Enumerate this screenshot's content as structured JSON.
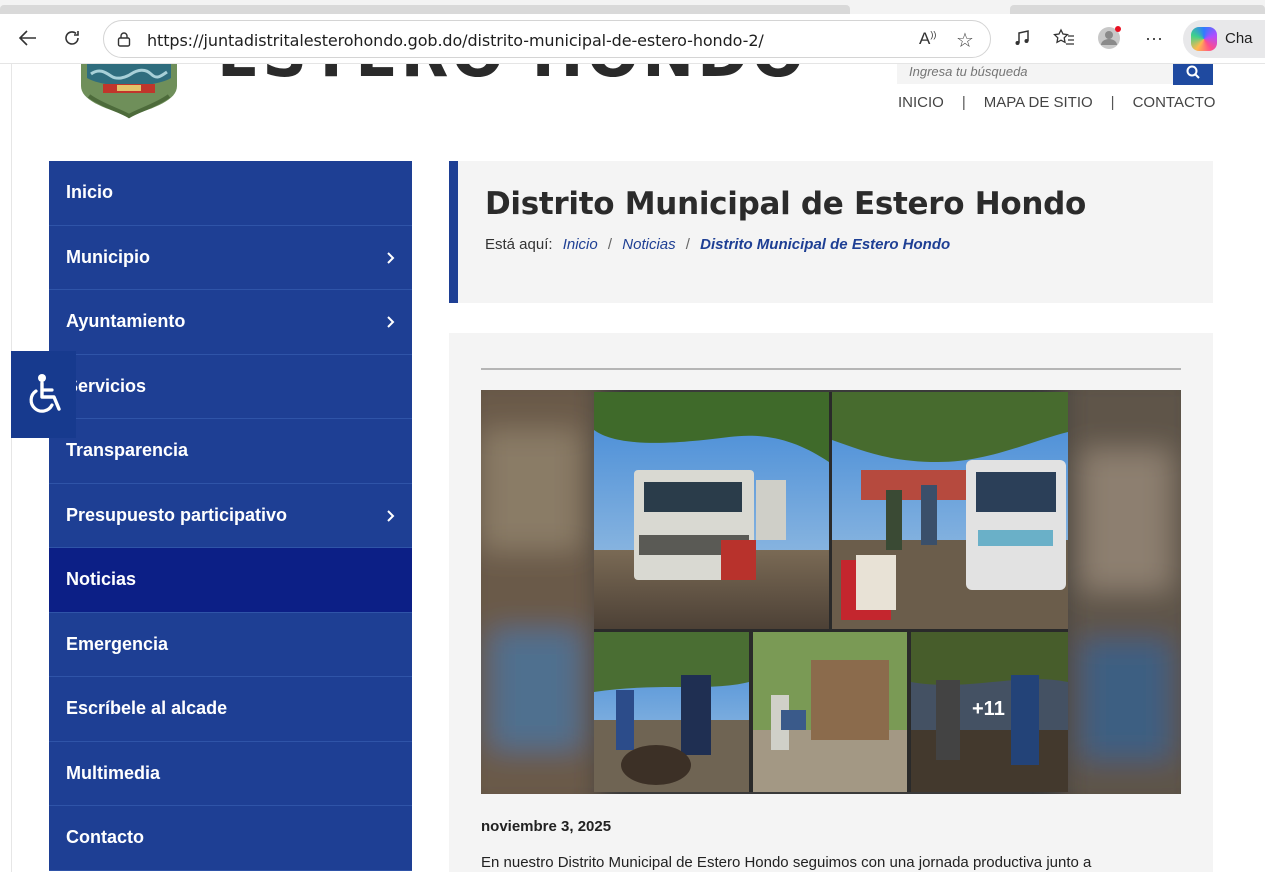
{
  "browser": {
    "url": "https://juntadistritalesterohondo.gob.do/distrito-municipal-de-estero-hondo-2/",
    "copilot_label": "Cha",
    "read_aloud_glyph": "A̩"
  },
  "site": {
    "name": "ESTERO HONDO",
    "search_placeholder": "Ingresa tu búsqueda",
    "top_nav": [
      "INICIO",
      "MAPA DE SITIO",
      "CONTACTO"
    ],
    "nav_separator": "|"
  },
  "sidebar": {
    "items": [
      {
        "label": "Inicio",
        "has_submenu": false,
        "active": false
      },
      {
        "label": "Municipio",
        "has_submenu": true,
        "active": false
      },
      {
        "label": "Ayuntamiento",
        "has_submenu": true,
        "active": false
      },
      {
        "label": "Servicios",
        "has_submenu": false,
        "active": false
      },
      {
        "label": "Transparencia",
        "has_submenu": false,
        "active": false
      },
      {
        "label": "Presupuesto participativo",
        "has_submenu": true,
        "active": false
      },
      {
        "label": "Noticias",
        "has_submenu": false,
        "active": true
      },
      {
        "label": "Emergencia",
        "has_submenu": false,
        "active": false
      },
      {
        "label": "Escríbele al alcade",
        "has_submenu": false,
        "active": false
      },
      {
        "label": "Multimedia",
        "has_submenu": false,
        "active": false
      },
      {
        "label": "Contacto",
        "has_submenu": false,
        "active": false
      }
    ]
  },
  "header": {
    "title": "Distrito Municipal de Estero Hondo",
    "breadcrumb_prefix": "Está aquí:",
    "breadcrumb": [
      "Inicio",
      "Noticias"
    ],
    "breadcrumb_current": "Distrito Municipal de Estero Hondo",
    "breadcrumb_separator": "/"
  },
  "post": {
    "gallery_more_count": "+11",
    "date": "noviembre 3, 2025",
    "excerpt": "En nuestro Distrito Municipal de Estero Hondo seguimos con una jornada productiva junto a"
  },
  "colors": {
    "nav_blue": "#1e3f94",
    "nav_active": "#0c1f86",
    "header_bg": "#f4f4f4"
  }
}
